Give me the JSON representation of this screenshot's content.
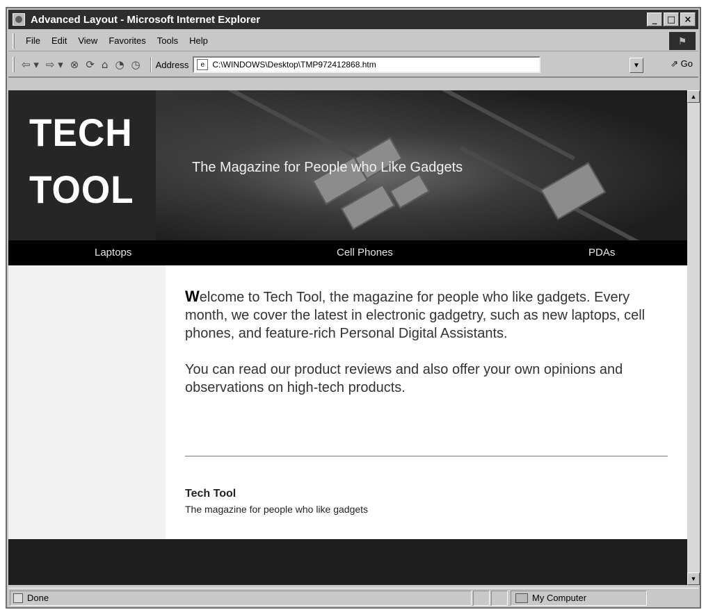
{
  "window": {
    "title": "Advanced Layout - Microsoft Internet Explorer",
    "buttons": {
      "minimize": "_",
      "maximize": "□",
      "close": "×"
    }
  },
  "menu": {
    "items": [
      "File",
      "Edit",
      "View",
      "Favorites",
      "Tools",
      "Help"
    ]
  },
  "toolbar": {
    "back": "⇦ ▾",
    "forward": "⇨ ▾",
    "stop": "⊗",
    "refresh": "⟳",
    "home": "⌂",
    "search": "◔",
    "history": "◷",
    "address_label": "Address",
    "address_value": "C:\\WINDOWS\\Desktop\\TMP972412868.htm",
    "dropdown": "▼",
    "go_label": "Go"
  },
  "page": {
    "logo_line1": "TECH",
    "logo_line2": "TOOL",
    "tagline": "The Magazine for People who Like Gadgets",
    "nav": [
      "Laptops",
      "Cell Phones",
      "PDAs"
    ],
    "intro_dropcap": "W",
    "intro_rest": "elcome to Tech Tool, the magazine for people who like gadgets. Every month, we cover the latest in electronic gadgetry, such as new laptops, cell phones, and feature-rich Personal Digital Assistants.",
    "paragraph2": "You can read our product reviews and also offer your own opinions and observations on high-tech products.",
    "footer_title": "Tech Tool",
    "footer_subtitle": "The magazine for people who like gadgets"
  },
  "scrollbar": {
    "up": "▲",
    "down": "▼"
  },
  "status": {
    "text": "Done",
    "zone": "My Computer"
  }
}
